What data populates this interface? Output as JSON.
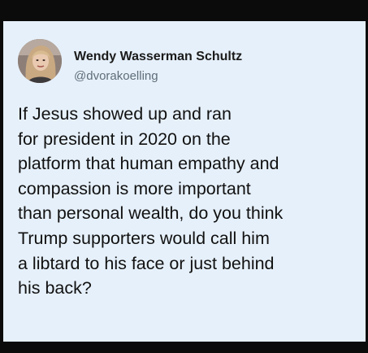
{
  "tweet": {
    "author": {
      "display_name": "Wendy Wasserman Schultz",
      "handle": "@dvorakoelling",
      "avatar_icon": "profile-photo"
    },
    "text_lines": [
      "If Jesus showed up and ran",
      "for president in 2020 on the",
      "platform that human empathy and",
      "compassion is more important",
      "than personal wealth, do you think",
      "Trump supporters would call him",
      "a libtard to his face or just behind",
      "his back?"
    ]
  },
  "colors": {
    "card_background": "#e6f0fa",
    "frame": "#0b0b0b",
    "name_text": "#1b1b1b",
    "handle_text": "#5f6e7a",
    "body_text": "#111111"
  }
}
